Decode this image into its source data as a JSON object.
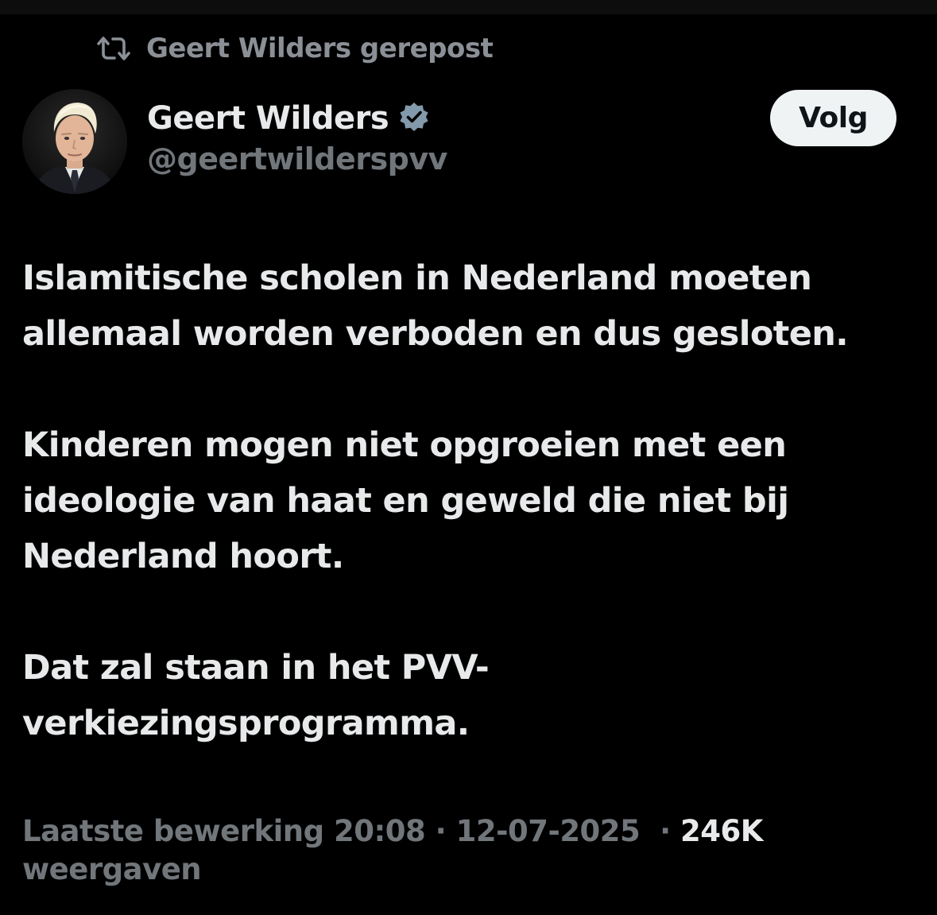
{
  "repost": {
    "icon": "repost-icon",
    "label": "Geert Wilders gerepost"
  },
  "author": {
    "display_name": "Geert Wilders",
    "handle": "@geertwilderspvv",
    "verified": true,
    "verified_icon": "verified-badge-icon"
  },
  "follow_button": {
    "label": "Volg"
  },
  "tweet": {
    "paragraphs": [
      "Islamitische scholen in Nederland moeten allemaal worden verboden en dus gesloten.",
      "Kinderen mogen niet opgroeien met een ideologie van haat en geweld die niet bij Nederland hoort.",
      "Dat zal staan in het PVV-verkiezingsprogramma."
    ]
  },
  "meta": {
    "edited_label": "Laatste bewerking",
    "time": "20:08",
    "date": "12-07-2025",
    "views_count": "246K",
    "views_label": "weergaven",
    "separator": "·"
  },
  "colors": {
    "background": "#000000",
    "text_primary": "#e7e9ea",
    "text_secondary": "#71767b",
    "verified_badge": "#829aab",
    "follow_button_bg": "#eff3f4"
  }
}
